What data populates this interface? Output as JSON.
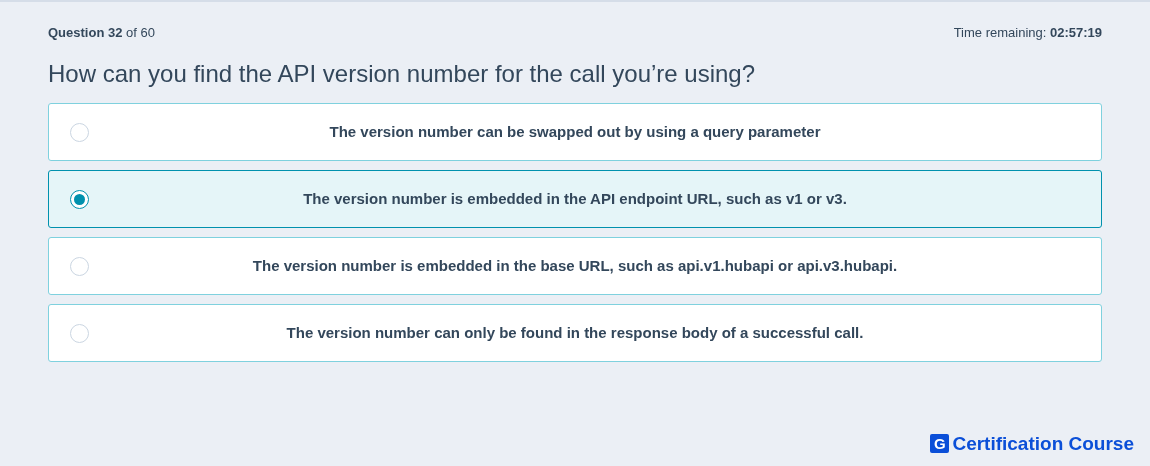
{
  "header": {
    "progress": "**Question 32** of 60",
    "timer": "Time remaining: **02:57:19**"
  },
  "question": "How can you find the API version number for the call you’re using?",
  "options": [
    {
      "label": "The version number can be swapped out by using a query parameter",
      "selected": false
    },
    {
      "label": "The version number is embedded in the API endpoint URL, such as v1 or v3.",
      "selected": true
    },
    {
      "label": "The version number is embedded in the base URL, such as api.v1.hubapi or api.v3.hubapi.",
      "selected": false
    },
    {
      "label": "The version number can only be found in the response body of a successful call.",
      "selected": false
    }
  ],
  "footer": {
    "logo_letter": "G",
    "brand": "Certification Course"
  }
}
